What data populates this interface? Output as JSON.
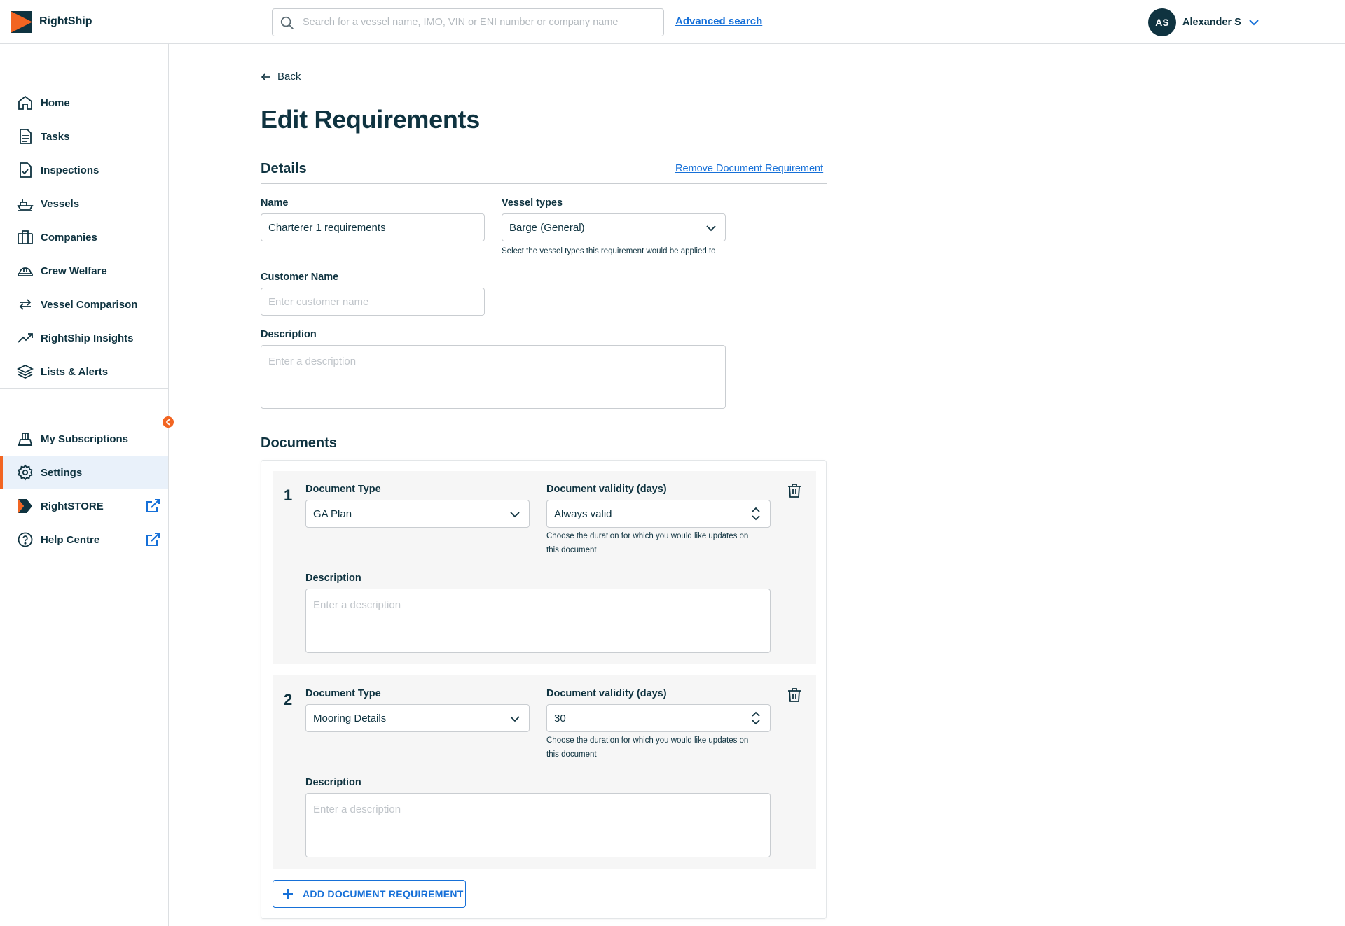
{
  "app": {
    "brand": "RightShip"
  },
  "header": {
    "search_placeholder": "Search for a vessel name, IMO, VIN or ENI number or company name",
    "advanced_search": "Advanced search",
    "user_initials": "AS",
    "user_name": "Alexander S"
  },
  "sidebar": {
    "items": [
      {
        "label": "Home",
        "icon": "home-icon"
      },
      {
        "label": "Tasks",
        "icon": "tasks-icon"
      },
      {
        "label": "Inspections",
        "icon": "inspections-icon"
      },
      {
        "label": "Vessels",
        "icon": "ship-icon"
      },
      {
        "label": "Companies",
        "icon": "briefcase-icon"
      },
      {
        "label": "Crew Welfare",
        "icon": "helmet-icon"
      },
      {
        "label": "Vessel Comparison",
        "icon": "compare-arrows-icon"
      },
      {
        "label": "RightShip Insights",
        "icon": "trend-up-icon"
      },
      {
        "label": "Lists & Alerts",
        "icon": "layers-icon"
      }
    ],
    "bottom_items": [
      {
        "label": "My Subscriptions",
        "icon": "subscriptions-icon"
      },
      {
        "label": "Settings",
        "icon": "gear-icon",
        "active": true
      },
      {
        "label": "RightSTORE",
        "icon": "rightstore-logo-icon",
        "external": true
      },
      {
        "label": "Help Centre",
        "icon": "help-icon",
        "external": true
      }
    ]
  },
  "page": {
    "back_label": "Back",
    "title": "Edit Requirements",
    "details_heading": "Details",
    "remove_link": "Remove Document Requirement",
    "name_label": "Name",
    "name_value": "Charterer 1 requirements",
    "vessel_types_label": "Vessel types",
    "vessel_types_value": "Barge (General)",
    "vessel_types_hint": "Select the vessel types this requirement would be applied to",
    "customer_name_label": "Customer Name",
    "customer_name_placeholder": "Enter customer name",
    "description_label": "Description",
    "description_placeholder": "Enter a description",
    "documents_heading": "Documents",
    "add_button": "ADD DOCUMENT REQUIREMENT"
  },
  "documents": [
    {
      "number": "1",
      "type_label": "Document Type",
      "type_value": "GA Plan",
      "validity_label": "Document validity (days)",
      "validity_value": "Always valid",
      "validity_hint_line1": "Choose the duration for which you would like updates on",
      "validity_hint_line2": "this document",
      "description_label": "Description",
      "description_placeholder": "Enter a description"
    },
    {
      "number": "2",
      "type_label": "Document Type",
      "type_value": "Mooring Details",
      "validity_label": "Document validity (days)",
      "validity_value": "30",
      "validity_hint_line1": "Choose the duration for which you would like updates on",
      "validity_hint_line2": "this document",
      "description_label": "Description",
      "description_placeholder": "Enter a description"
    }
  ],
  "colors": {
    "primary_dark": "#0f3340",
    "accent_orange": "#f26522",
    "link_blue": "#1670d8",
    "active_bg": "#e9f1fa"
  }
}
